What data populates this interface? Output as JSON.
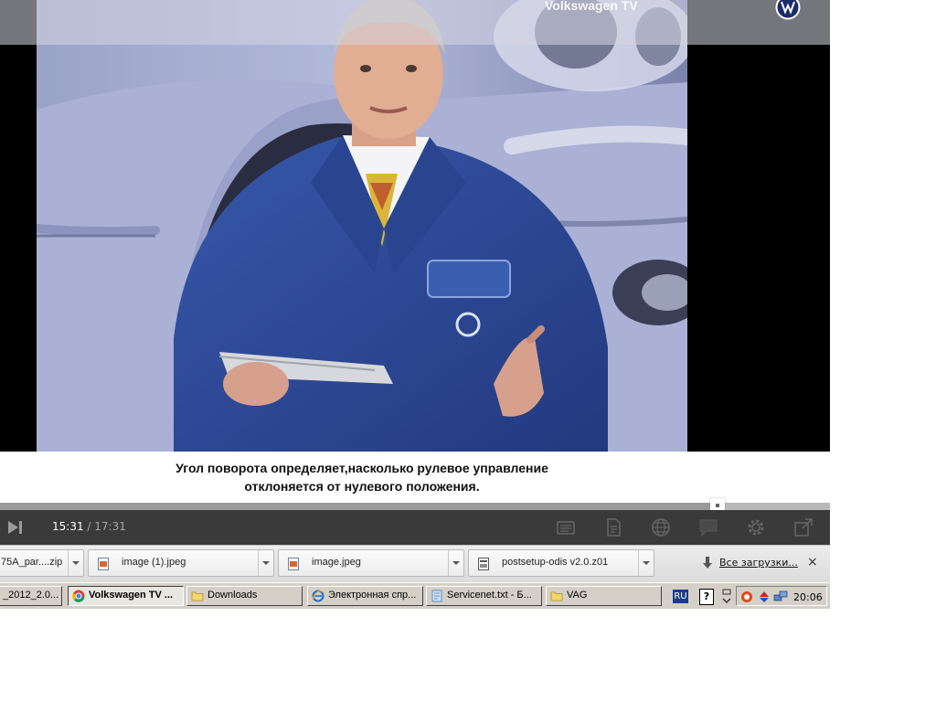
{
  "video": {
    "brand": "Volkswagen TV",
    "subtitle_lines": [
      "Угол поворота определяет,насколько рулевое управление",
      "отклоняется от нулевого положения."
    ]
  },
  "player": {
    "time_current": "15:31",
    "time_separator": " / ",
    "time_total": "17:31",
    "progress_fraction": 0.8645,
    "icons": [
      "next-track-icon",
      "chapters-icon",
      "transcript-icon",
      "language-icon",
      "comments-icon",
      "settings-icon",
      "popout-icon"
    ]
  },
  "downloads": {
    "items": [
      {
        "name": "75A_par....zip",
        "icon": "zip-file-icon"
      },
      {
        "name": "image (1).jpeg",
        "icon": "image-file-icon"
      },
      {
        "name": "image.jpeg",
        "icon": "image-file-icon"
      },
      {
        "name": "postsetup-odis v2.0.z01",
        "icon": "archive-file-icon"
      }
    ],
    "all_label": "Все загрузки...",
    "close_label": "×"
  },
  "taskbar": {
    "buttons": [
      {
        "label": "_2012_2.0...",
        "icon": "none",
        "active": false
      },
      {
        "label": "Volkswagen TV ...",
        "icon": "chrome-icon",
        "active": true
      },
      {
        "label": "Downloads",
        "icon": "folder-icon",
        "active": false
      },
      {
        "label": "Электронная спр...",
        "icon": "ie-icon",
        "active": false
      },
      {
        "label": "Servicenet.txt - Б...",
        "icon": "notepad-icon",
        "active": false
      },
      {
        "label": "VAG",
        "icon": "folder-icon",
        "active": false
      }
    ],
    "lang": "RU",
    "help": "?",
    "clock": "20:06"
  },
  "colors": {
    "control_bar": "#3a3a3a",
    "progress_played": "#9a9a9a",
    "coat_blue": "#2f4c9a",
    "car_silver": "#b8bfdc"
  }
}
